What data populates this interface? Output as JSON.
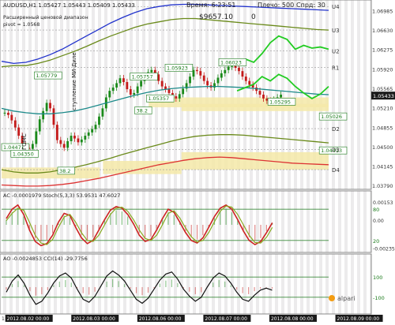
{
  "header": {
    "symbol_line": "AUDUSD,H1  1.05427 1.05443 1.05409 1.05433",
    "subtitle": "Расширенный ценовой диапазон",
    "pivot_label": "pivot = 1.0568",
    "timer": "Время: 6:23:51",
    "leverage": "Плечо: 500",
    "spread": "Спрд: 30",
    "balance": "$9657.10",
    "profit": "0",
    "vertical_text_1": "ГОМС",
    "vertical_text_2": "ступление МИ-Диле"
  },
  "chart_data": [
    {
      "type": "line",
      "panel": "price",
      "title": "AUDUSD,H1",
      "ylim": [
        1.0375,
        1.0715
      ],
      "y_ticks": [
        {
          "v": 1.06985,
          "label": "1.06985"
        },
        {
          "v": 1.0663,
          "label": "1.06630"
        },
        {
          "v": 1.06275,
          "label": "1.06275"
        },
        {
          "v": 1.0592,
          "label": "1.05920"
        },
        {
          "v": 1.05565,
          "label": "1.05565"
        },
        {
          "v": 1.0521,
          "label": "1.05210"
        },
        {
          "v": 1.04855,
          "label": "1.04855"
        },
        {
          "v": 1.045,
          "label": "1.04500"
        },
        {
          "v": 1.04145,
          "label": "1.04145"
        },
        {
          "v": 1.0379,
          "label": "1.03790"
        }
      ],
      "current_price": {
        "v": 1.05433,
        "label": "1.05433"
      },
      "pivot_levels": [
        {
          "name": "U4",
          "v": 1.0706
        },
        {
          "name": "U3",
          "v": 1.0663
        },
        {
          "name": "U2",
          "v": 1.0625
        },
        {
          "name": "R1",
          "v": 1.0595
        },
        {
          "name": "D2",
          "v": 1.0483
        },
        {
          "name": "D3",
          "v": 1.0445
        },
        {
          "name": "D4",
          "v": 1.0408
        }
      ],
      "price_labels": [
        {
          "text": "1.05779",
          "t": 14,
          "v": 1.0578
        },
        {
          "text": "1.05757",
          "t": 55,
          "v": 1.0576
        },
        {
          "text": "1.05923",
          "t": 70,
          "v": 1.0592
        },
        {
          "text": "1.05357",
          "t": 62,
          "v": 1.0536
        },
        {
          "text": "1.06023",
          "t": 93,
          "v": 1.0602
        },
        {
          "text": "1.05295",
          "t": 114,
          "v": 1.053
        },
        {
          "text": "1.04471",
          "t": 0,
          "v": 1.0447
        },
        {
          "text": "1.04350",
          "t": 4,
          "v": 1.0435
        },
        {
          "text": "38.2",
          "t": 24,
          "v": 1.0404
        },
        {
          "text": "38.2",
          "t": 57,
          "v": 1.0514
        },
        {
          "text": "1.05026",
          "t": 136,
          "v": 1.0503
        },
        {
          "text": "1.04413",
          "t": 136,
          "v": 1.0441
        }
      ],
      "x_labels": [
        {
          "t": 0,
          "label": "1 A"
        },
        {
          "t": 2,
          "label": "2012.08.02 00:00"
        },
        {
          "t": 27,
          "label": "2012.08.03 00:00"
        },
        {
          "t": 52,
          "label": "2012.08.06 00:00"
        },
        {
          "t": 77,
          "label": "2012.08.07 00:00"
        },
        {
          "t": 102,
          "label": "2012.08.08 00:00"
        },
        {
          "t": 127,
          "label": "2012.08.09 00:00"
        }
      ],
      "series": [
        {
          "type": "candles",
          "color_up": "#1a8a1a",
          "color_down": "#c41a1a",
          "close": [
            1.0512,
            1.0508,
            1.0498,
            1.0485,
            1.047,
            1.0452,
            1.0448,
            1.0446,
            1.0455,
            1.0478,
            1.05,
            1.0515,
            1.053,
            1.052,
            1.049,
            1.0462,
            1.0455,
            1.0448,
            1.046,
            1.047,
            1.0465,
            1.0458,
            1.0463,
            1.047,
            1.0476,
            1.0482,
            1.049,
            1.0505,
            1.052,
            1.054,
            1.0552,
            1.0558,
            1.0566,
            1.0575,
            1.0568,
            1.0555,
            1.0545,
            1.0548,
            1.056,
            1.057,
            1.0578,
            1.0586,
            1.059,
            1.0582,
            1.057,
            1.056,
            1.0555,
            1.0548,
            1.0542,
            1.0538,
            1.0546,
            1.0556,
            1.0566,
            1.0578,
            1.059,
            1.0588,
            1.058,
            1.057,
            1.0562,
            1.0558,
            1.0566,
            1.0576,
            1.0584,
            1.059,
            1.0596,
            1.06,
            1.0594,
            1.0588,
            1.0578,
            1.057,
            1.0563,
            1.0558,
            1.0552,
            1.0545,
            1.0538,
            1.0534,
            1.0532,
            1.0536,
            1.054,
            1.0545
          ]
        },
        {
          "type": "line",
          "name": "",
          "color": "#1d8a8a",
          "values": [
            1.052,
            1.0515,
            1.0512,
            1.051,
            1.051,
            1.0512,
            1.0515,
            1.052,
            1.0526,
            1.0532,
            1.0538,
            1.0544,
            1.0549,
            1.0553,
            1.0556,
            1.0558,
            1.0559,
            1.056,
            1.056,
            1.0559,
            1.0558,
            1.0556,
            1.0554,
            1.0552,
            1.055,
            1.0548,
            1.0546,
            1.0545
          ]
        },
        {
          "type": "line",
          "name": "",
          "color": "#6a8a1a",
          "values": [
            1.0596,
            1.0598,
            1.0598,
            1.0602,
            1.0608,
            1.0616,
            1.0624,
            1.0633,
            1.0643,
            1.0652,
            1.066,
            1.0668,
            1.0674,
            1.0678,
            1.0682,
            1.0684,
            1.0684,
            1.0682,
            1.068,
            1.0678,
            1.0676,
            1.0674,
            1.0672,
            1.067,
            1.0668,
            1.0666,
            1.0664,
            1.0663
          ]
        },
        {
          "type": "line",
          "name": "",
          "color": "#6a8a1a",
          "values": [
            1.0408,
            1.0404,
            1.0402,
            1.0402,
            1.0404,
            1.0408,
            1.0412,
            1.0417,
            1.0423,
            1.0429,
            1.0436,
            1.0442,
            1.0448,
            1.0454,
            1.046,
            1.0465,
            1.0469,
            1.0471,
            1.0472,
            1.0472,
            1.0471,
            1.0469,
            1.0467,
            1.0465,
            1.0463,
            1.0461,
            1.0459,
            1.0457
          ]
        },
        {
          "type": "line",
          "name": "",
          "color": "#2233cc",
          "values": [
            1.0606,
            1.0602,
            1.0604,
            1.061,
            1.0618,
            1.0628,
            1.064,
            1.0652,
            1.0664,
            1.0676,
            1.0686,
            1.0695,
            1.0702,
            1.0706,
            1.0709,
            1.071,
            1.071,
            1.0709,
            1.0708,
            1.0707,
            1.0706,
            1.0705,
            1.0704,
            1.0703,
            1.0702,
            1.0701,
            1.07,
            1.0699
          ]
        },
        {
          "type": "line",
          "name": "",
          "color": "#dd3333",
          "values": [
            1.038,
            1.0379,
            1.0378,
            1.0378,
            1.0379,
            1.0381,
            1.0384,
            1.0388,
            1.0392,
            1.0397,
            1.0402,
            1.0407,
            1.0412,
            1.0417,
            1.0421,
            1.0425,
            1.0428,
            1.043,
            1.0431,
            1.043,
            1.0428,
            1.0426,
            1.0424,
            1.0422,
            1.042,
            1.0419,
            1.0418,
            1.0417
          ]
        },
        {
          "type": "forecast",
          "name": "",
          "color": "#22cc22",
          "values": [
            1.06,
            1.061,
            1.0604,
            1.062,
            1.064,
            1.0652,
            1.0646,
            1.0628,
            1.0635,
            1.063,
            1.0632,
            1.0628
          ]
        },
        {
          "type": "forecast",
          "name": "",
          "color": "#22cc22",
          "values": [
            1.0552,
            1.0558,
            1.0564,
            1.0578,
            1.057,
            1.0582,
            1.0575,
            1.056,
            1.0548,
            1.0538,
            1.0546,
            1.056
          ]
        }
      ]
    },
    {
      "type": "line",
      "panel": "oscillator-1",
      "title": "AC -0.0001979  Stoch(5,3,3) 53.9531 47.6027",
      "ylim": [
        -0.0026,
        0.0018
      ],
      "y_ticks": [
        {
          "v": 0.00153,
          "label": "0.00153"
        },
        {
          "v": 0.0,
          "label": "0.00"
        },
        {
          "v": -0.00235,
          "label": "-0.00235"
        }
      ],
      "levels": [
        {
          "v": 80,
          "label": "80"
        },
        {
          "v": 20,
          "label": "20"
        }
      ],
      "series": [
        {
          "name": "Main",
          "color": "#cc2222",
          "values": [
            62,
            80,
            88,
            70,
            40,
            18,
            10,
            14,
            30,
            55,
            72,
            68,
            45,
            25,
            14,
            20,
            40,
            60,
            78,
            85,
            82,
            70,
            52,
            30,
            18,
            22,
            40,
            62,
            80,
            74,
            55,
            35,
            20,
            15,
            25,
            45,
            66,
            82,
            88,
            80,
            60,
            38,
            20,
            12,
            18,
            35,
            54
          ]
        },
        {
          "name": "Signal",
          "color": "#88aa22",
          "values": [
            58,
            72,
            82,
            78,
            55,
            30,
            15,
            12,
            22,
            45,
            65,
            70,
            55,
            35,
            20,
            18,
            30,
            50,
            70,
            82,
            84,
            76,
            60,
            40,
            24,
            20,
            30,
            50,
            72,
            77,
            63,
            44,
            27,
            17,
            20,
            35,
            56,
            76,
            86,
            84,
            70,
            50,
            30,
            16,
            15,
            26,
            45
          ]
        }
      ]
    },
    {
      "type": "line",
      "panel": "oscillator-2",
      "title": "AO -0.0024853  CCI(14) -29.7756",
      "ylim": [
        -250,
        250
      ],
      "levels": [
        {
          "v": 100,
          "label": "100"
        },
        {
          "v": -100,
          "label": "-100"
        }
      ],
      "series": [
        {
          "name": "CCI(14)",
          "color": "#111111",
          "values": [
            -50,
            60,
            120,
            40,
            -80,
            -170,
            -140,
            -60,
            40,
            110,
            140,
            90,
            -20,
            -120,
            -150,
            -90,
            10,
            110,
            160,
            120,
            60,
            -30,
            -120,
            -160,
            -110,
            -20,
            70,
            130,
            150,
            80,
            -20,
            -90,
            -140,
            -100,
            0,
            90,
            140,
            110,
            40,
            -50,
            -120,
            -140,
            -80,
            -30,
            -10,
            -30
          ]
        }
      ]
    }
  ],
  "branding": {
    "logo_text": "alpari"
  }
}
